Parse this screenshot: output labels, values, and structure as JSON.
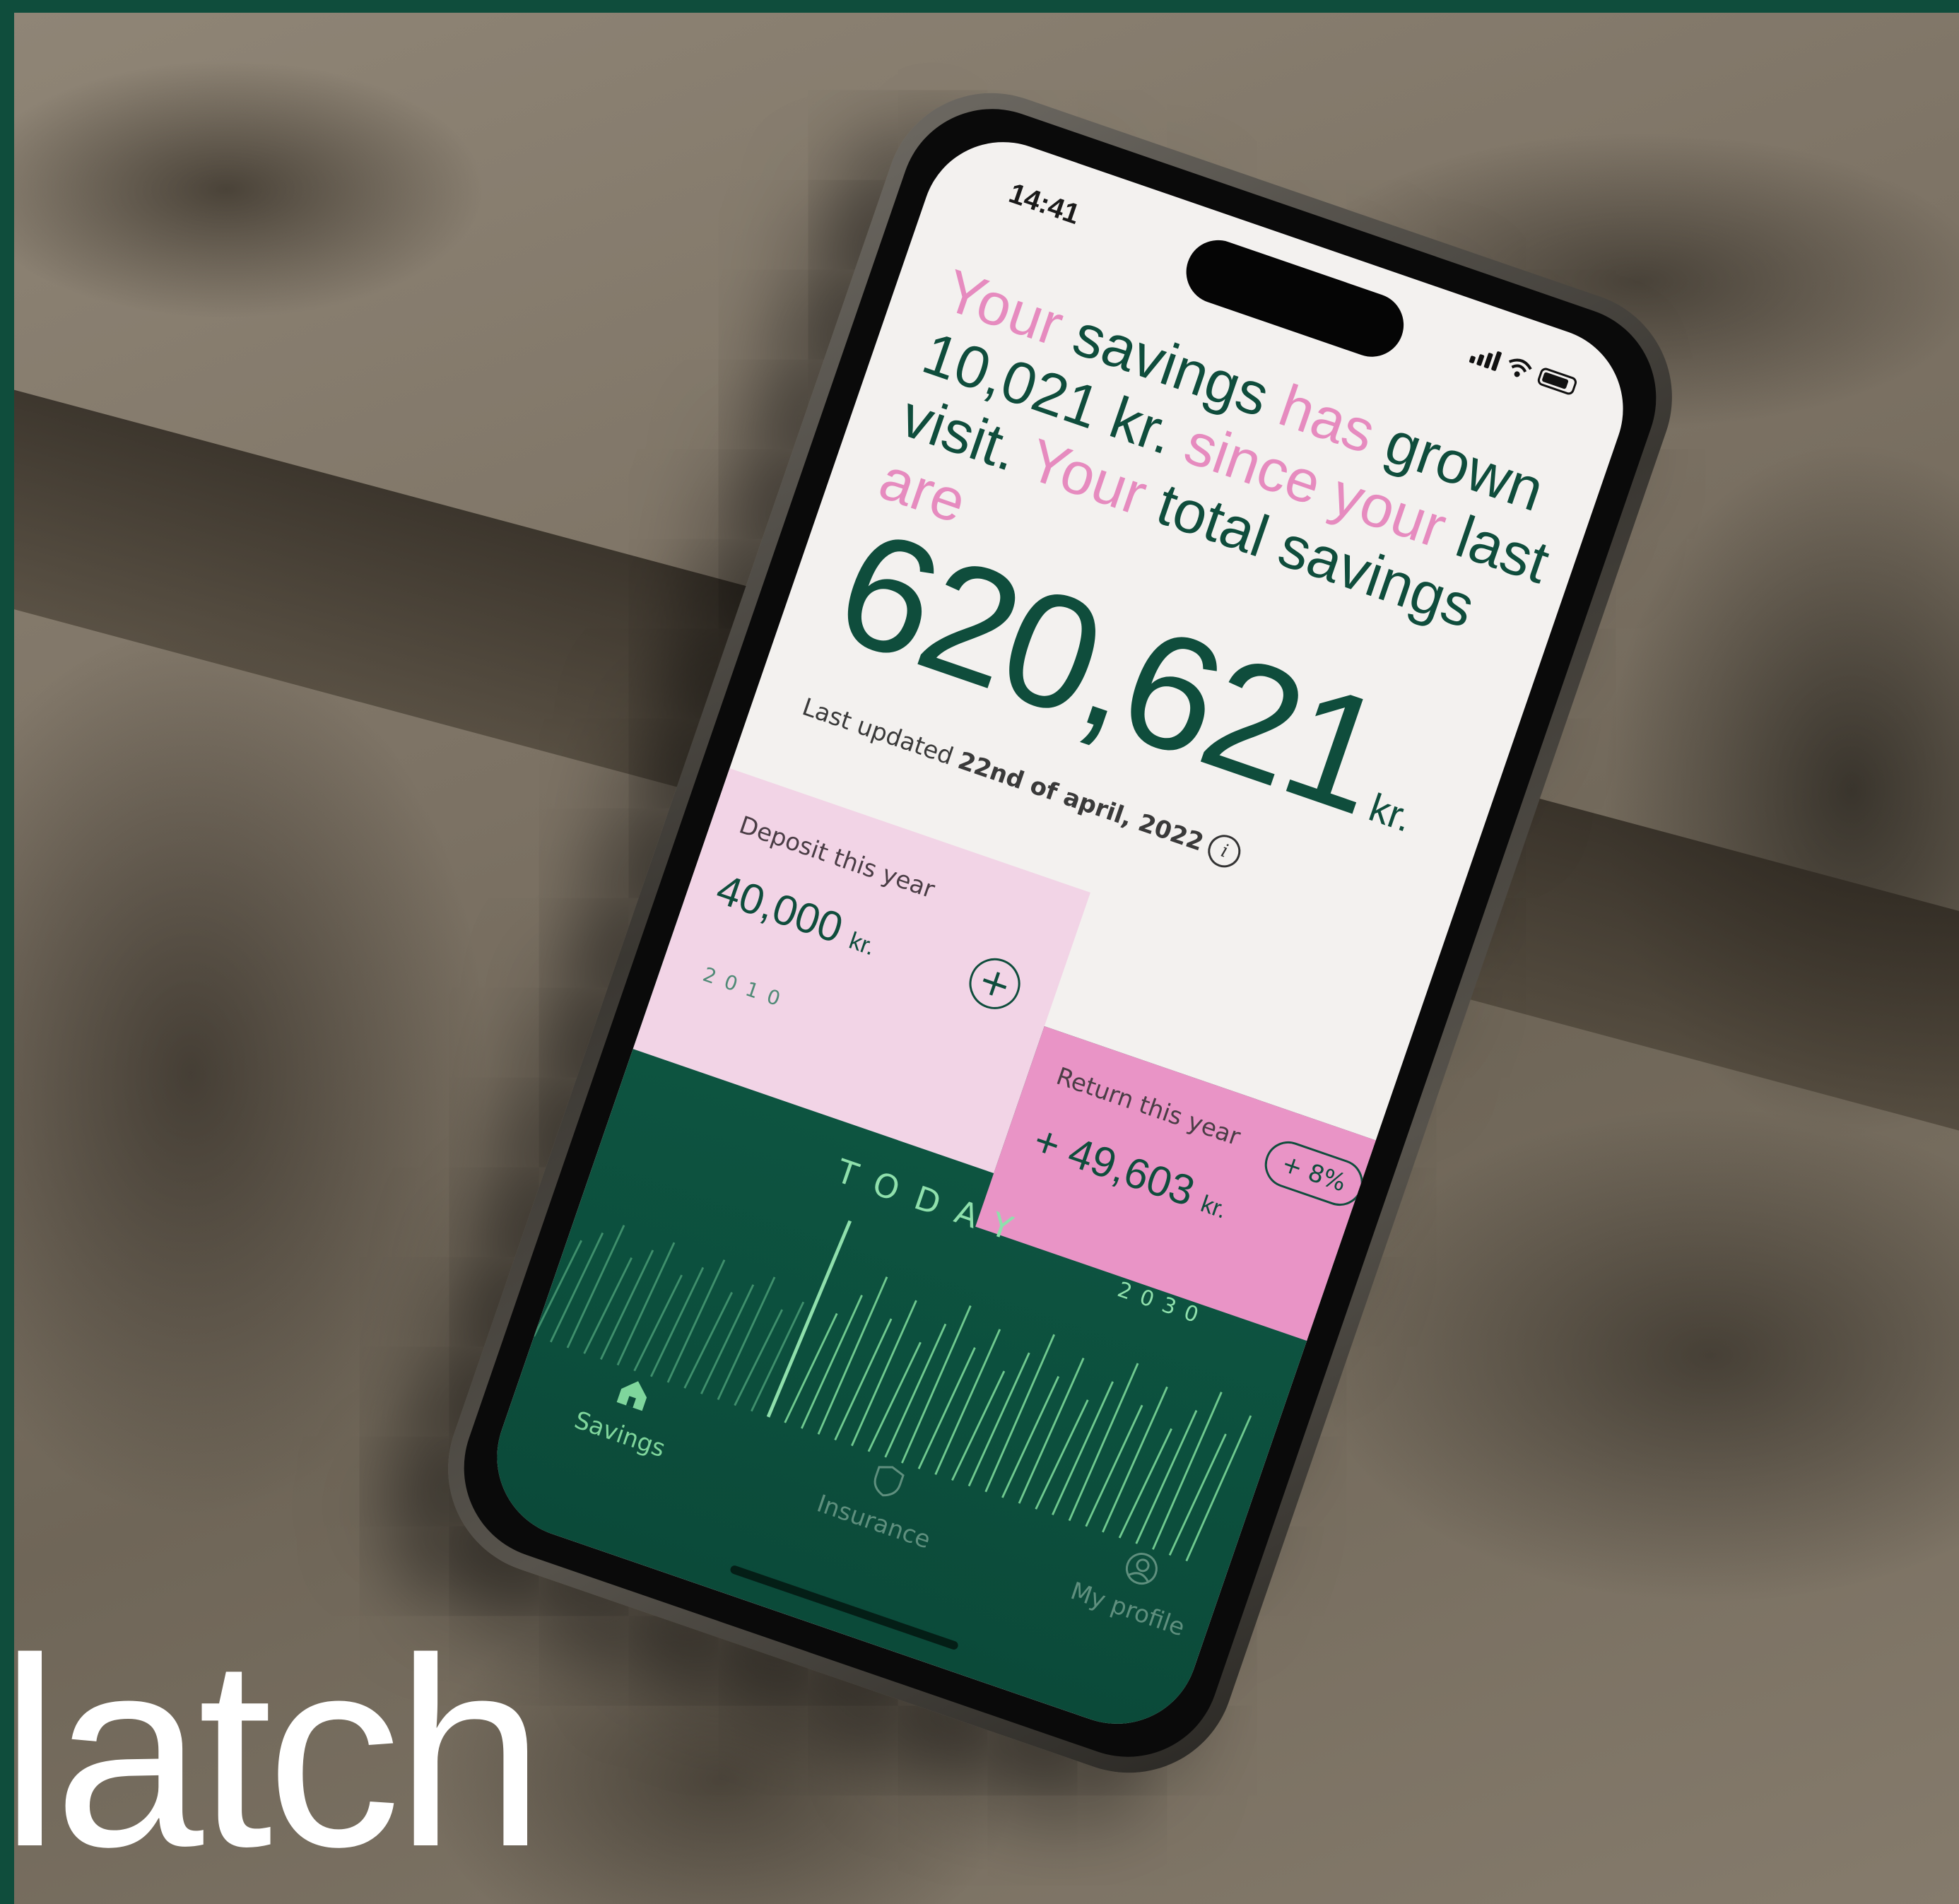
{
  "brand": {
    "text": "latch"
  },
  "status": {
    "time": "14:41"
  },
  "headline": {
    "segments": [
      {
        "text": "Your ",
        "pink": true
      },
      {
        "text": "savings ",
        "pink": false
      },
      {
        "text": "has ",
        "pink": true
      },
      {
        "text": "grown 10,021 kr. ",
        "pink": false
      },
      {
        "text": "since your ",
        "pink": true
      },
      {
        "text": "last visit. ",
        "pink": false
      },
      {
        "text": "Your ",
        "pink": true
      },
      {
        "text": "total savings ",
        "pink": false
      },
      {
        "text": "are",
        "pink": true
      }
    ]
  },
  "total": {
    "value": "620,621",
    "unit": "kr."
  },
  "updated": {
    "prefix": "Last updated",
    "date": "22nd of april, 2022",
    "info_icon": "i"
  },
  "deposit": {
    "label": "Deposit this year",
    "value": "40,000",
    "unit": "kr.",
    "button": "+"
  },
  "return": {
    "label": "Return this year",
    "value": "+ 49,603",
    "unit": "kr.",
    "badge": "+ 8%"
  },
  "timeline": {
    "start_year": "2010",
    "today_label": "TODAY",
    "end_year": "2030"
  },
  "nav": {
    "items": [
      {
        "label": "Savings",
        "icon": "home-icon",
        "active": true
      },
      {
        "label": "Insurance",
        "icon": "shield-icon",
        "active": false
      },
      {
        "label": "My profile",
        "icon": "profile-icon",
        "active": false
      }
    ]
  },
  "colors": {
    "brand_green": "#0f4d3c",
    "pink": "#e68bbf",
    "light_pink": "#f2d4e6",
    "accent_green": "#7fd69c"
  }
}
